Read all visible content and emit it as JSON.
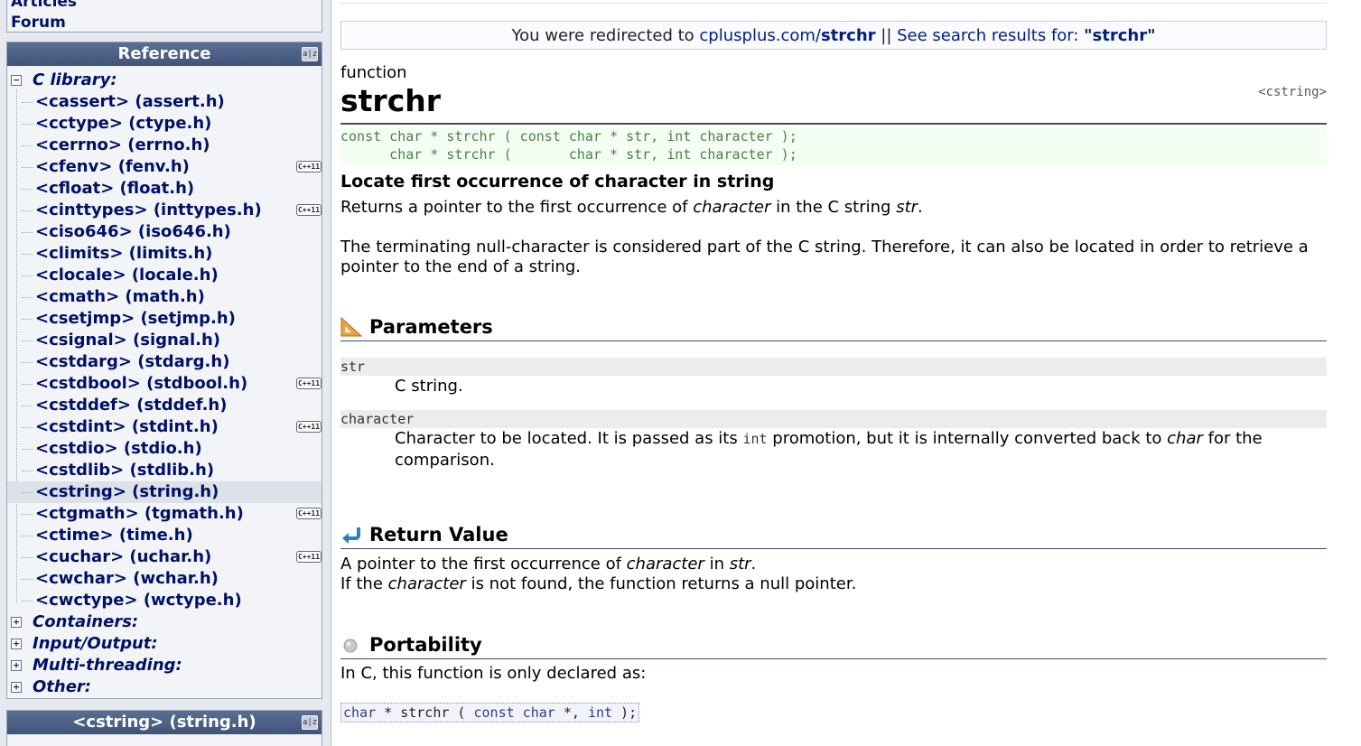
{
  "sidebar": {
    "top_links": [
      "Articles",
      "Forum"
    ],
    "reference": {
      "title": "Reference",
      "az_icon": "a|z",
      "sections": [
        {
          "label": "C library:",
          "expanded": true,
          "items": [
            {
              "label": "<cassert> (assert.h)",
              "cxx11": false
            },
            {
              "label": "<cctype> (ctype.h)",
              "cxx11": false
            },
            {
              "label": "<cerrno> (errno.h)",
              "cxx11": false
            },
            {
              "label": "<cfenv> (fenv.h)",
              "cxx11": true
            },
            {
              "label": "<cfloat> (float.h)",
              "cxx11": false
            },
            {
              "label": "<cinttypes> (inttypes.h)",
              "cxx11": true
            },
            {
              "label": "<ciso646> (iso646.h)",
              "cxx11": false
            },
            {
              "label": "<climits> (limits.h)",
              "cxx11": false
            },
            {
              "label": "<clocale> (locale.h)",
              "cxx11": false
            },
            {
              "label": "<cmath> (math.h)",
              "cxx11": false
            },
            {
              "label": "<csetjmp> (setjmp.h)",
              "cxx11": false
            },
            {
              "label": "<csignal> (signal.h)",
              "cxx11": false
            },
            {
              "label": "<cstdarg> (stdarg.h)",
              "cxx11": false
            },
            {
              "label": "<cstdbool> (stdbool.h)",
              "cxx11": true
            },
            {
              "label": "<cstddef> (stddef.h)",
              "cxx11": false
            },
            {
              "label": "<cstdint> (stdint.h)",
              "cxx11": true
            },
            {
              "label": "<cstdio> (stdio.h)",
              "cxx11": false
            },
            {
              "label": "<cstdlib> (stdlib.h)",
              "cxx11": false
            },
            {
              "label": "<cstring> (string.h)",
              "cxx11": false,
              "selected": true
            },
            {
              "label": "<ctgmath> (tgmath.h)",
              "cxx11": true
            },
            {
              "label": "<ctime> (time.h)",
              "cxx11": false
            },
            {
              "label": "<cuchar> (uchar.h)",
              "cxx11": true
            },
            {
              "label": "<cwchar> (wchar.h)",
              "cxx11": false
            },
            {
              "label": "<cwctype> (wctype.h)",
              "cxx11": false
            }
          ]
        },
        {
          "label": "Containers:",
          "expanded": false
        },
        {
          "label": "Input/Output:",
          "expanded": false
        },
        {
          "label": "Multi-threading:",
          "expanded": false
        },
        {
          "label": "Other:",
          "expanded": false
        }
      ],
      "cxx11_badge": "C++11",
      "toggle_expanded": "−",
      "toggle_collapsed": "+"
    },
    "header_box": {
      "title": "<cstring> (string.h)",
      "az_icon": "a|z"
    }
  },
  "main": {
    "redirect": {
      "prefix": "You were redirected to ",
      "link_domain": "cplusplus.com/",
      "link_term": "strchr",
      "separator": " || ",
      "search_text": "See search results for: ",
      "search_term": "\"strchr\""
    },
    "kind": "function",
    "title": "strchr",
    "header_tag": "<cstring>",
    "prototypes": [
      "const char * strchr ( const char * str, int character );",
      "      char * strchr (       char * str, int character );"
    ],
    "heading": "Locate first occurrence of character in string",
    "description": {
      "p1": [
        "Returns a pointer to the first occurrence of ",
        "character",
        " in the C string ",
        "str",
        "."
      ],
      "p2": "The terminating null-character is considered part of the C string. Therefore, it can also be located in order to retrieve a pointer to the end of a string."
    },
    "parameters": {
      "title": "Parameters",
      "items": [
        {
          "name": "str",
          "desc": "C string."
        },
        {
          "name": "character",
          "desc_parts": [
            "Character to be located. It is passed as its ",
            "int",
            " promotion, but it is internally converted back to ",
            "char",
            " for the comparison."
          ]
        }
      ]
    },
    "return_value": {
      "title": "Return Value",
      "line1": [
        "A pointer to the first occurrence of ",
        "character",
        " in ",
        "str",
        "."
      ],
      "line2": [
        "If the ",
        "character",
        " is not found, the function returns a null pointer."
      ]
    },
    "portability": {
      "title": "Portability",
      "text": "In C, this function is only declared as:",
      "code": [
        "char",
        " * strchr ( ",
        "const char",
        " *, ",
        "int",
        " );"
      ]
    }
  }
}
